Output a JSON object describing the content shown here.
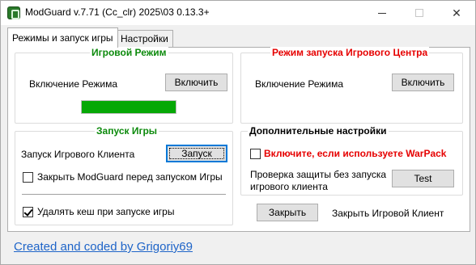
{
  "window": {
    "title": "ModGuard v.7.71 (Cc_clr) 2025\\03 0.13.3+",
    "minimize_glyph": "—",
    "close_glyph": "✕"
  },
  "tabs": [
    {
      "label": "Режимы и запуск игры",
      "active": true
    },
    {
      "label": "Настройки",
      "active": false
    }
  ],
  "game_mode": {
    "title": "Игровой Режим",
    "enable_label": "Включение Режима",
    "enable_button": "Включить",
    "status_fill": 1.0,
    "status_color": "#06a806"
  },
  "center_mode": {
    "title": "Режим запуска Игрового Центра",
    "enable_label": "Включение Режима",
    "enable_button": "Включить"
  },
  "game_launch": {
    "title": "Запуск Игры",
    "client_label": "Запуск Игрового Клиента",
    "launch_button": "Запуск",
    "close_modguard_label": "Закрыть ModGuard перед запуском Игры",
    "close_modguard_checked": false,
    "clear_cache_label": "Удалять кеш при запуске игры",
    "clear_cache_checked": true
  },
  "extra_settings": {
    "title": "Дополнительные настройки",
    "warpack_label": "Включите, если используете WarPack",
    "warpack_checked": false,
    "protection_label_line1": "Проверка защиты без запуска",
    "protection_label_line2": "игрового клиента",
    "test_button": "Test"
  },
  "bottom": {
    "close_button": "Закрыть",
    "close_client_label": "Закрыть Игровой Клиент",
    "credits_link": "Created and coded by Grigoriy69"
  },
  "colors": {
    "green_title": "#0c8a0c",
    "red_title": "#e60000",
    "link": "#1e64c8"
  }
}
